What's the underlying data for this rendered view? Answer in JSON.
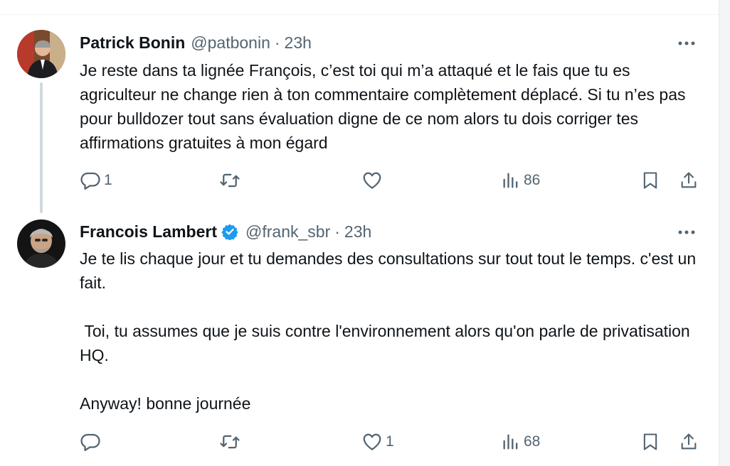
{
  "tweets": [
    {
      "author_name": "Patrick Bonin",
      "handle": "@patbonin",
      "separator": "·",
      "time": "23h",
      "verified": false,
      "avatar": "avatar-photo",
      "text": [
        "Je reste dans ta lignée François, c’est toi qui m’a attaqué et le fais que tu es agriculteur ne change rien à ton commentaire complètement déplacé. Si tu n’es pas pour bulldozer tout sans évaluation digne de ce nom alors tu dois corriger tes affirmations gratuites à mon égard"
      ],
      "actions": {
        "replies": "1",
        "retweets": "",
        "likes": "",
        "views": "86"
      }
    },
    {
      "author_name": "Francois Lambert",
      "handle": "@frank_sbr",
      "separator": "·",
      "time": "23h",
      "verified": true,
      "verified_color": "#1d9bf0",
      "avatar": "avatar-photo",
      "text": [
        "Je te lis chaque jour et tu demandes des consultations sur tout tout le temps. c'est un fait.",
        " Toi, tu assumes que je suis contre l'environnement alors qu'on parle de privatisation HQ.",
        "Anyway! bonne journée"
      ],
      "actions": {
        "replies": "",
        "retweets": "",
        "likes": "1",
        "views": "68"
      }
    }
  ],
  "icons": [
    "reply-icon",
    "retweet-icon",
    "like-icon",
    "views-icon",
    "bookmark-icon",
    "share-icon",
    "more-icon",
    "verified-badge-icon"
  ],
  "colors": {
    "text": "#0f1419",
    "secondary": "#536471",
    "thread_line": "#cfd9de",
    "verified": "#1d9bf0"
  }
}
